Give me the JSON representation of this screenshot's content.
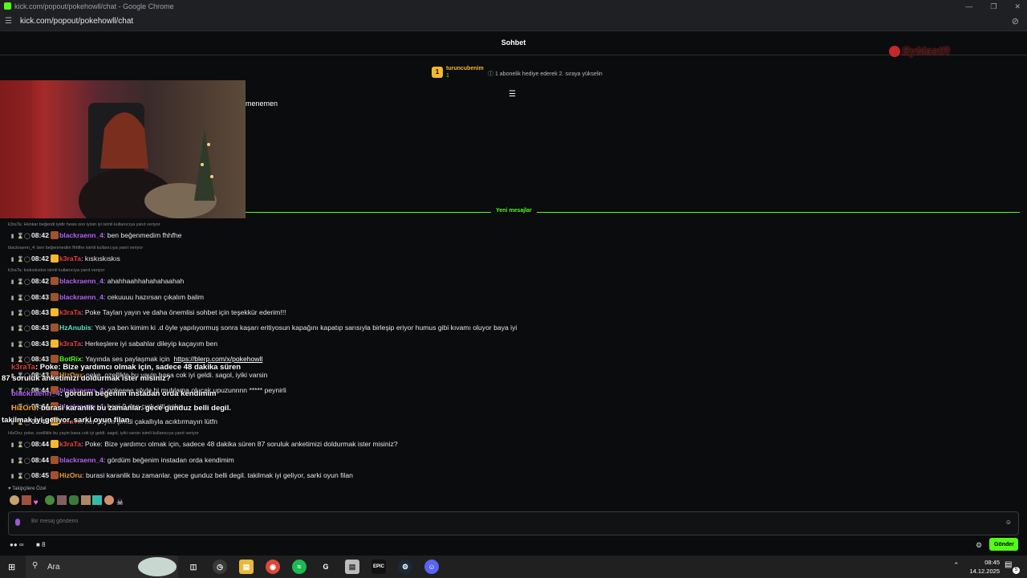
{
  "window": {
    "title": "kick.com/popout/pokehowll/chat - Google Chrome",
    "url": "kick.com/popout/pokehowll/chat"
  },
  "chat": {
    "header": "Sohbet",
    "new_messages_label": "Yeni mesajlar",
    "stray_text": "menemen"
  },
  "overlay": {
    "logo_text": "ByMastR"
  },
  "pinned": {
    "rank": "1",
    "user": "turuncubenim",
    "count": "1",
    "info": "1 abonelik hediye ederek 2. sıraya yükselin"
  },
  "colors": {
    "accent": "#53fc18",
    "purple": "#b062f5",
    "red": "#e2403e",
    "teal": "#5ce0c0",
    "orange": "#f0a030",
    "green": "#53fc18"
  },
  "messages": [
    {
      "reply": "k3raTa: Hünkar beğendi iyidir hews ooo iyisin iyi isimli kullanıcıya yanıt veriyor",
      "time": "08:42",
      "user": "blackraenn_4",
      "color": "#b062f5",
      "text": "ben beğenmedim fhhfhe"
    },
    {
      "reply": "blackraenn_4: ben beğenmedim fhhfhe isimli kullanıcıya yanıt veriyor",
      "time": "08:42",
      "user": "k3raTa",
      "color": "#e2403e",
      "text": "kıskıskıskıs"
    },
    {
      "reply": "k3raTa: kıskıskıskıs isimli kullanıcıya yanıt veriyor",
      "time": "08:42",
      "user": "blackraenn_4",
      "color": "#b062f5",
      "text": "ahahhaahhahahahaahah"
    },
    {
      "reply": "",
      "time": "08:43",
      "user": "blackraenn_4",
      "color": "#b062f5",
      "text": "cekuuuu hazırsan çıkalım balim"
    },
    {
      "reply": "",
      "time": "08:43",
      "user": "k3raTa",
      "color": "#e2403e",
      "text": "Poke Taylan yayın ve daha önemlisi sohbet için teşekkür ederim!!!"
    },
    {
      "reply": "",
      "time": "08:43",
      "user": "HzAnubis",
      "color": "#5ce0c0",
      "text": "Yok ya ben kimim ki .d öyle yapılıyormuş sonra kaşarı eritiyosun kapağını kapatıp sarısıyla birleşip eriyor humus gibi kıvamı oluyor baya iyi"
    },
    {
      "reply": "",
      "time": "08:43",
      "user": "k3raTa",
      "color": "#e2403e",
      "text": "Herkeşlere iyi sabahlar dileyip kaçayım ben"
    },
    {
      "reply": "",
      "time": "08:43",
      "user": "BotRix",
      "color": "#53fc18",
      "text": "Yayında ses paylaşmak için",
      "link": "https://blerp.com/x/pokehowll"
    },
    {
      "reply": "",
      "time": "08:43",
      "user": "HizOru",
      "color": "#f0a030",
      "text": "poke, ozellikle bu yayin bana cok iyi geldi. sagol, iyiki varsin"
    },
    {
      "reply": "",
      "time": "08:44",
      "user": "blackraenn_4",
      "color": "#b062f5",
      "text": "pokeeee söyle bi muhlama olucak upuzunnnn ***** peynirli"
    },
    {
      "reply": "",
      "time": "08:44",
      "user": "blackraenn_4",
      "color": "#b062f5",
      "text": "beni 0 dan çıplı etti poke"
    },
    {
      "reply": "",
      "time": "08:44",
      "user": "k3raTa",
      "color": "#e2403e",
      "text": "her şeyim şimdi çakallıyla acıktırmayın lütfn"
    },
    {
      "reply": "HizOru: poke, ozellikle bu yayin bana cok iyi geldi. sagol, iyiki varsin isimli kullanıcıya yanıt veriyor",
      "time": "08:44",
      "user": "k3raTa",
      "color": "#e2403e",
      "text": "Poke: Bize yardımcı olmak için, sadece 48 dakika süren 87 soruluk anketimizi doldurmak ister misiniz?"
    },
    {
      "reply": "",
      "time": "08:44",
      "user": "blackraenn_4",
      "color": "#b062f5",
      "text": "gördüm beğenim instadan orda kendimim"
    },
    {
      "reply": "",
      "time": "08:45",
      "user": "HizOru",
      "color": "#f0a030",
      "text": "burasi karanlik bu zamanlar. gece gunduz belli degil. takilmak iyi geliyor, sarki oyun filan"
    }
  ],
  "tts_overlay": [
    {
      "user": "k3raTa",
      "color": "#e2403e",
      "text": ": Poke: Bize yardımcı olmak için, sadece 48 dakika süren"
    },
    {
      "user": "",
      "color": "#ffffff",
      "text": "87 soruluk anketimizi doldurmak ister misiniz?"
    },
    {
      "user": "blackraenn_4",
      "color": "#b062f5",
      "text": ": gördüm beğenim instadan orda kendimim"
    },
    {
      "user": "HizOru",
      "color": "#f0a030",
      "text": ": burasi karanlik bu zamanlar. gece gunduz belli degil."
    },
    {
      "user": "",
      "color": "#ffffff",
      "text": "takilmak iyi geliyor, sarki oyun filan"
    }
  ],
  "emote_bar": {
    "label": "Takipçilere Özel"
  },
  "input": {
    "placeholder": "Bir mesaj gönderin"
  },
  "bottom": {
    "influence": "∞",
    "points": "8",
    "send_label": "Gönder"
  },
  "taskbar": {
    "search_placeholder": "Ara",
    "time": "08:45",
    "date": "14.12.2025",
    "notif_count": "5"
  }
}
